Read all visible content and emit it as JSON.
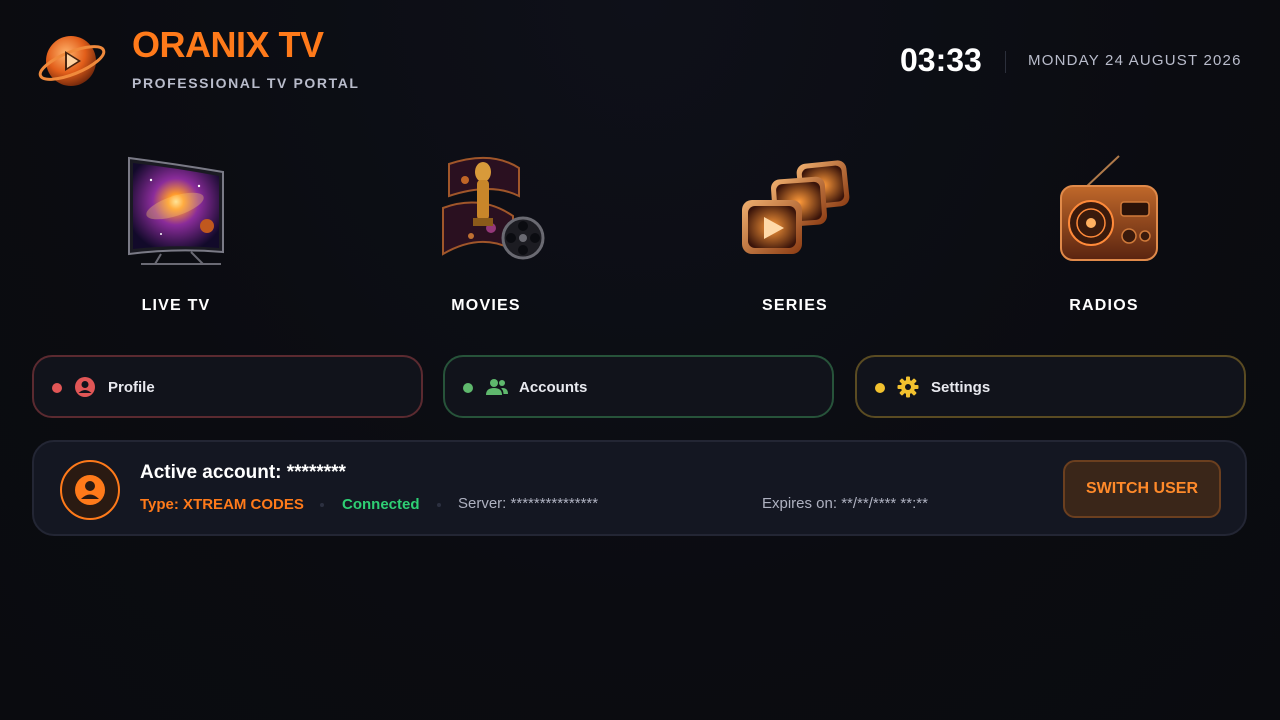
{
  "colors": {
    "accent": "#ff7a1a",
    "background": "#0b0c11",
    "profile": "#e15656",
    "accounts": "#5fb86d",
    "settings": "#f2c12e",
    "connected": "#2ecf74"
  },
  "header": {
    "logo_icon": "planet-play-logo",
    "title": "ORANIX TV",
    "subtitle": "PROFESSIONAL TV PORTAL",
    "time": "03:33",
    "date": "MONDAY 24 AUGUST 2026"
  },
  "tiles": [
    {
      "label": "LIVE TV",
      "icon": "curved-tv-galaxy-icon"
    },
    {
      "label": "MOVIES",
      "icon": "film-reel-trophy-icon"
    },
    {
      "label": "SERIES",
      "icon": "stacked-play-screens-icon"
    },
    {
      "label": "RADIOS",
      "icon": "vintage-radio-icon"
    }
  ],
  "quick_actions": [
    {
      "label": "Profile",
      "icon": "user-circle-icon"
    },
    {
      "label": "Accounts",
      "icon": "users-group-icon"
    },
    {
      "label": "Settings",
      "icon": "gear-icon"
    }
  ],
  "account": {
    "title": "Active account: ********",
    "type": "Type: XTREAM CODES",
    "status": "Connected",
    "server": "Server: ***************",
    "expires": "Expires on: **/**/**** **:**",
    "switch_label": "SWITCH USER",
    "avatar_icon": "user-circle-icon"
  }
}
